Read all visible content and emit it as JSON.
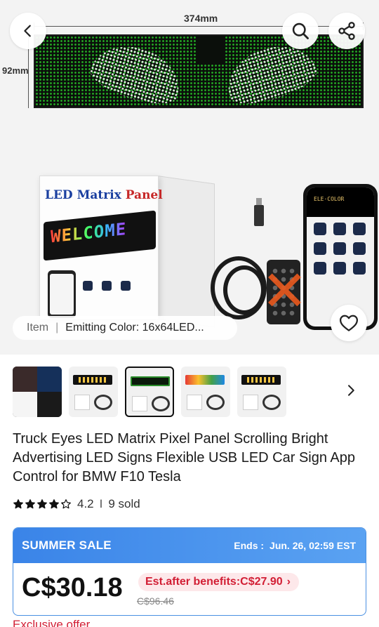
{
  "hero": {
    "dimension_width": "374mm",
    "dimension_height": "92mm",
    "box_title_part1": "LED Matrix ",
    "box_title_part2": "Panel",
    "box_led_text": "WELCOME",
    "info_label": "Item",
    "info_separator": "|",
    "info_value": "Emitting Color: 16x64LED..."
  },
  "icons": {
    "back": "chevron-left-icon",
    "search": "search-icon",
    "share": "share-icon",
    "favorite": "heart-icon",
    "next": "chevron-right-icon",
    "star": "star-icon"
  },
  "thumbnails": {
    "count": 5,
    "selected_index": 2
  },
  "product": {
    "title": "Truck Eyes LED Matrix Pixel Panel Scrolling Bright Advertising LED Signs Flexible USB LED Car Sign App Control for BMW F10 Tesla",
    "rating": "4.2",
    "rating_value": 4.2,
    "rating_separator": "I",
    "sold": "9 sold"
  },
  "sale": {
    "name": "SUMMER SALE",
    "ends_label": "Ends :",
    "ends_time": "Jun. 26, 02:59 EST",
    "price": "C$30.18",
    "after_benefits": "Est.after benefits:C$27.90",
    "after_benefits_chevron": "›",
    "original_price": "C$96.46"
  },
  "footer": {
    "exclusive": "Exclusive offer"
  },
  "colors": {
    "sale_header": "#3a84e8",
    "accent_red": "#d21f35",
    "benefit_bg": "#fde8ea"
  }
}
